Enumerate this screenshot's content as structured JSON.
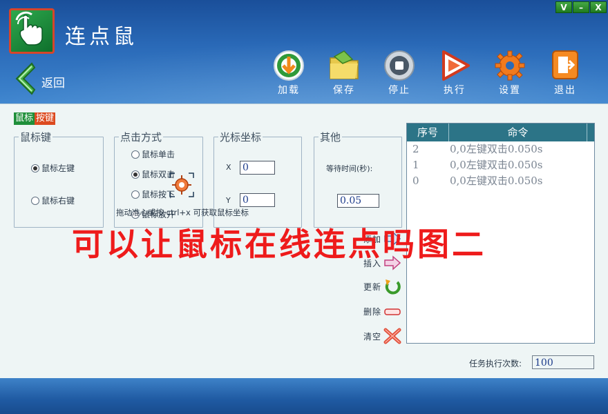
{
  "window": {
    "title": "连点鼠",
    "controls": [
      "V",
      "–",
      "X"
    ]
  },
  "nav": {
    "back_label": "返回"
  },
  "toolbar": [
    {
      "label": "加载",
      "icon": "load-icon"
    },
    {
      "label": "保存",
      "icon": "save-folder-icon"
    },
    {
      "label": "停止",
      "icon": "stop-icon"
    },
    {
      "label": "执行",
      "icon": "play-icon"
    },
    {
      "label": "设置",
      "icon": "gear-icon"
    },
    {
      "label": "退出",
      "icon": "exit-icon"
    }
  ],
  "tab": {
    "part1": "鼠标",
    "part2": "按键"
  },
  "mouse_key": {
    "legend": "鼠标键",
    "options": [
      "鼠标左键",
      "鼠标右键"
    ],
    "selected": 0
  },
  "click_mode": {
    "legend": "点击方式",
    "options": [
      "鼠标单击",
      "鼠标双击",
      "鼠标按下",
      "鼠标放开"
    ],
    "selected": 1
  },
  "cursor": {
    "legend": "光标坐标",
    "x_label": "X",
    "y_label": "Y",
    "x_value": "0",
    "y_value": "0"
  },
  "other": {
    "legend": "其他",
    "wait_label": "等待时间(秒):",
    "wait_value": "0.05"
  },
  "hint": "拖动准心或按 ctrl+x 可获取鼠标坐标",
  "side_buttons": [
    {
      "label": "添加",
      "icon": "arrow-right-icon"
    },
    {
      "label": "插入",
      "icon": "insert-arrow-icon"
    },
    {
      "label": "更新",
      "icon": "refresh-icon"
    },
    {
      "label": "删除",
      "icon": "minus-icon"
    },
    {
      "label": "清空",
      "icon": "clear-x-icon"
    }
  ],
  "command_list": {
    "headers": [
      "序号",
      "命令"
    ],
    "rows": [
      {
        "no": "2",
        "cmd": "0,0左键双击0.050s"
      },
      {
        "no": "1",
        "cmd": "0,0左键双击0.050s"
      },
      {
        "no": "0",
        "cmd": "0,0左键双击0.050s"
      }
    ]
  },
  "task": {
    "count_label": "任务执行次数:",
    "count_value": "100"
  },
  "overlay_caption": "可以让鼠标在线连点吗图二",
  "colors": {
    "header": "#2a6ab8",
    "content_bg": "#eef5f5",
    "list_header": "#2c7487",
    "overlay": "#ee1b1b",
    "tab_green": "#1f8f3a",
    "tab_red": "#dc4a1f"
  }
}
